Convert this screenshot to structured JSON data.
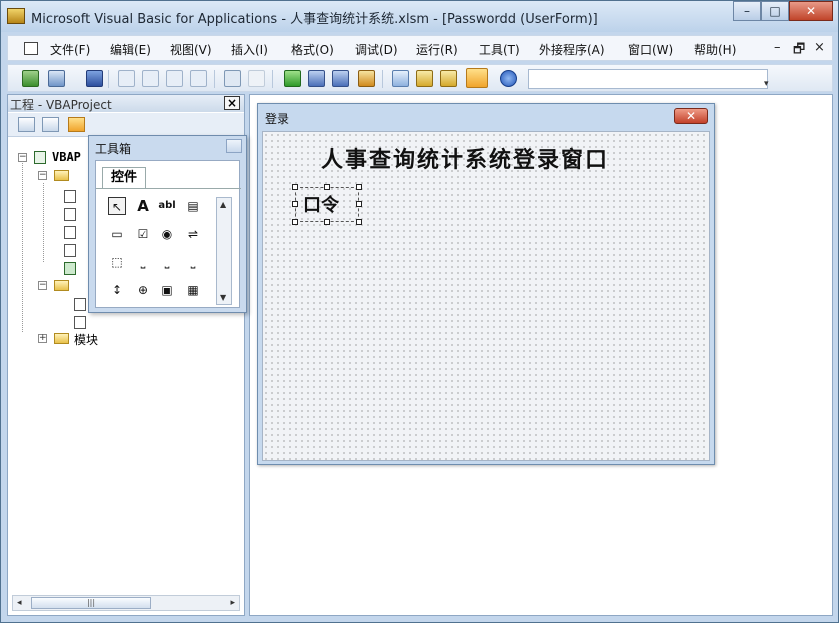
{
  "window": {
    "title": "Microsoft Visual Basic for Applications - 人事查询统计系统.xlsm - [Passwordd (UserForm)]",
    "minimize_label": "–",
    "maximize_label": "□",
    "close_label": "✕"
  },
  "menu": {
    "items": [
      "文件(F)",
      "编辑(E)",
      "视图(V)",
      "插入(I)",
      "格式(O)",
      "调试(D)",
      "运行(R)",
      "工具(T)",
      "外接程序(A)",
      "窗口(W)",
      "帮助(H)"
    ],
    "right_minimize": "–",
    "right_restore": "🗗",
    "right_close": "×"
  },
  "project_explorer": {
    "title": "工程 - VBAProject",
    "close_label": "×",
    "tree": {
      "root_label": "VBAP",
      "modules_label": "模块",
      "expanded_sign": "−",
      "collapsed_sign": "+"
    },
    "scroll_thumb_label": "|||"
  },
  "toolbox": {
    "title": "工具箱",
    "tab_label": "控件",
    "tools": [
      "↖",
      "A",
      "abl",
      "▤",
      "▭",
      "☑",
      "◉",
      "⇌",
      "⬚",
      "⎵",
      "⎵",
      "⎵",
      "↕",
      "⊕",
      "▣",
      "▦"
    ]
  },
  "userform": {
    "title": "登录",
    "close_label": "✕",
    "caption": "人事查询统计系统登录窗口",
    "label_text": "口令"
  }
}
